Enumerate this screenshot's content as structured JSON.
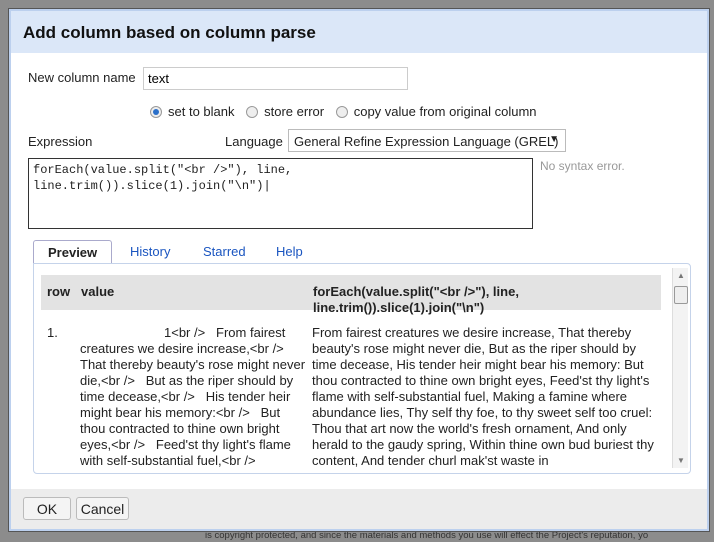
{
  "background_text": "is copyright protected, and since the materials and methods you use will effect the Project's reputation, yo",
  "dialog": {
    "title": "Add column based on column parse",
    "new_column_label": "New column name",
    "new_column_value": "text",
    "on_error": {
      "options": [
        "set to blank",
        "store error",
        "copy value from original column"
      ],
      "selected": "set to blank"
    },
    "expression_label": "Expression",
    "language_label": "Language",
    "language_value": "General Refine Expression Language (GREL)",
    "expression_line1": "forEach(value.split(\"<br />\"), line,",
    "expression_line2": "line.trim()).slice(1).join(\"\\n\")",
    "status": "No syntax error.",
    "tabs": [
      "Preview",
      "History",
      "Starred",
      "Help"
    ],
    "active_tab": "Preview",
    "preview": {
      "columns": [
        "row",
        "value",
        "forEach(value.split(\"<br />\"), line, line.trim()).slice(1).join(\"\\n\")"
      ],
      "rows": [
        {
          "row": "1.",
          "value": "1<br />   From fairest creatures we desire increase,<br />   That thereby beauty's rose might never die,<br />   But as the riper should by time decease,<br />   His tender heir might bear his memory:<br />   But thou contracted to thine own bright eyes,<br />   Feed'st thy light's flame with self-substantial fuel,<br />",
          "result": "From fairest creatures we desire increase, That thereby beauty's rose might never die, But as the riper should by time decease, His tender heir might bear his memory: But thou contracted to thine own bright eyes, Feed'st thy light's flame with self-substantial fuel, Making a famine where abundance lies, Thy self thy foe, to thy sweet self too cruel: Thou that art now the world's fresh ornament, And only herald to the gaudy spring, Within thine own bud buriest thy content, And tender churl mak'st waste in"
        }
      ]
    },
    "ok_label": "OK",
    "cancel_label": "Cancel"
  }
}
